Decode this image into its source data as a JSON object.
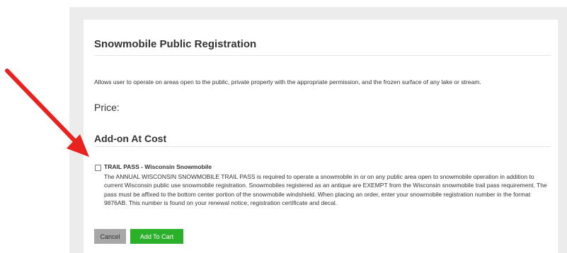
{
  "registration": {
    "title": "Snowmobile Public Registration",
    "description": "Allows user to operate on areas open to the public, private property with the appropriate permission, and the frozen surface of any lake or stream.",
    "price_label": "Price:"
  },
  "addons": {
    "heading": "Add-on At Cost",
    "items": [
      {
        "name": "TRAIL PASS - Wisconsin Snowmobile",
        "checked": false,
        "description": "The ANNUAL WISCONSIN SNOWMOBILE TRAIL PASS is required to operate a snowmobile in or on any public area open to snowmobile operation in addition to current Wisconsin public use snowmobile registration. Snowmobiles registered as an antique are EXEMPT from the Wisconsin snowmobile trail pass requirement. The pass must be affixed to the bottom center portion of the snowmobile windshield. When placing an order, enter your snowmobile registration number in the format 9876AB. This number is found on your renewal notice, registration certificate and decal."
      }
    ]
  },
  "actions": {
    "cancel_label": "Cancel",
    "add_to_cart_label": "Add To Cart"
  },
  "colors": {
    "arrow": "#e8221f",
    "add_button": "#2bb02b",
    "cancel_button": "#a7a7a7"
  },
  "icons": {
    "annotation": "red-arrow-icon"
  }
}
